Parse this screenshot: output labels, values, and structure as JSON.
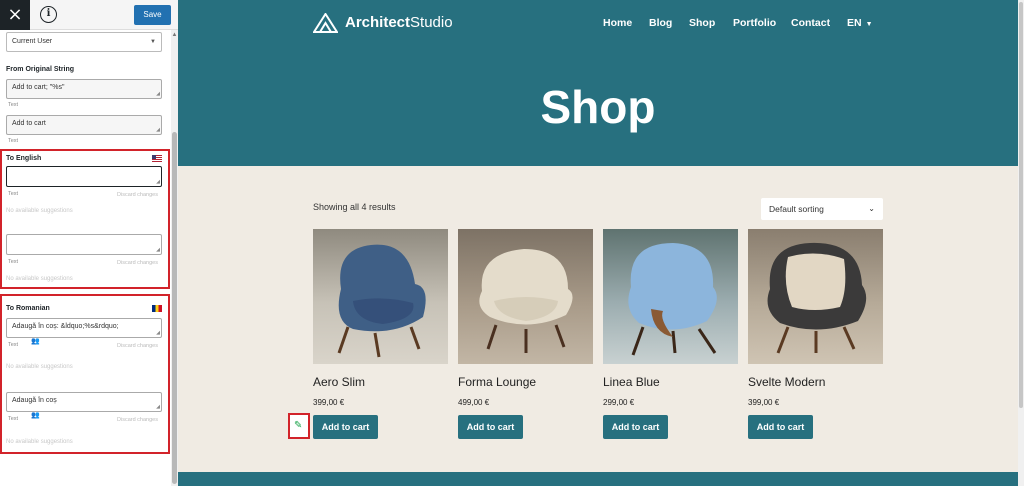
{
  "editor": {
    "close_icon": "×",
    "info_icon": "i",
    "save_label": "Save",
    "view_as_value": "Current User",
    "original_section_label": "From Original String",
    "original_strings": [
      "Add to cart; \"%s\"",
      "Add to cart"
    ],
    "text_label": "Text",
    "discard_label": "Discard changes",
    "no_suggestions": "No available suggestions",
    "english": {
      "label": "To English",
      "flag_icon": "us-flag-icon",
      "values": [
        "",
        ""
      ]
    },
    "romanian": {
      "label": "To Romanian",
      "flag_icon": "ro-flag-icon",
      "values": [
        "Adaugă în coș: &ldquo;%s&rdquo;",
        "Adaugă în coș"
      ]
    }
  },
  "site": {
    "brand_prefix": "Architect",
    "brand_suffix": "Studio",
    "nav": [
      "Home",
      "Blog",
      "Shop",
      "Portfolio",
      "Contact",
      "EN"
    ],
    "page_title": "Shop",
    "results_text": "Showing all 4 results",
    "sorting_value": "Default sorting",
    "add_to_cart_label": "Add to cart",
    "products": [
      {
        "name": "Aero Slim",
        "price": "399,00 €",
        "color": "#3f5f86"
      },
      {
        "name": "Forma Lounge",
        "price": "499,00 €",
        "color": "#e4dccb"
      },
      {
        "name": "Linea Blue",
        "price": "299,00 €",
        "color": "#8cb5dc"
      },
      {
        "name": "Svelte Modern",
        "price": "399,00 €",
        "color": "#e2d7c4"
      }
    ],
    "colors": {
      "brand": "#27707f",
      "background": "#f0ebe3",
      "highlight": "#d2232a",
      "save": "#2271b1"
    }
  }
}
